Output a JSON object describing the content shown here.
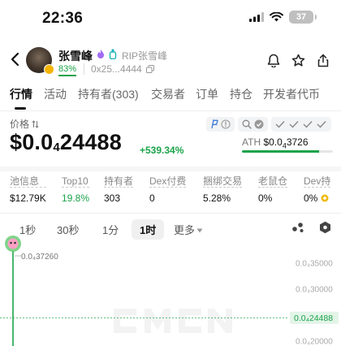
{
  "status_bar": {
    "time": "22:36",
    "battery": "37"
  },
  "header": {
    "name": "张雪峰",
    "subtitle": "RIP张雪峰",
    "percent": "83%",
    "address": "0x25...4444"
  },
  "tabs": [
    {
      "label": "行情",
      "active": true
    },
    {
      "label": "活动"
    },
    {
      "label": "持有者(303)"
    },
    {
      "label": "交易者"
    },
    {
      "label": "订单"
    },
    {
      "label": "持仓"
    },
    {
      "label": "开发者代币"
    }
  ],
  "price": {
    "label": "价格",
    "main": "$0.0",
    "main_sub": "4",
    "main_tail": "24488",
    "change": "+539.34%",
    "ath_label": "ATH",
    "ath_main": "$0.0",
    "ath_sub": "4",
    "ath_tail": "3726"
  },
  "stats": [
    {
      "label": "池信息",
      "value": "$12.79K"
    },
    {
      "label": "Top10",
      "value": "19.8%",
      "green": true
    },
    {
      "label": "持有者",
      "value": "303"
    },
    {
      "label": "Dex付费",
      "value": "0"
    },
    {
      "label": "捆绑交易",
      "value": "5.28%"
    },
    {
      "label": "老鼠仓",
      "value": "0%"
    },
    {
      "label": "Dev持",
      "value": "0%"
    }
  ],
  "intervals": [
    {
      "label": "1秒"
    },
    {
      "label": "30秒"
    },
    {
      "label": "1分"
    },
    {
      "label": "1时",
      "active": true
    },
    {
      "label": "更多"
    }
  ],
  "chart_data": {
    "type": "line",
    "high_label": "0.0₄37260",
    "y_ticks": [
      "0.0₄35000",
      "0.0₄30000",
      "0.0₄24488",
      "0.0₄20000"
    ],
    "y_tick_values": [
      3.5e-05,
      3e-05,
      2.4488e-05,
      2e-05
    ],
    "current_price": 2.4488e-05,
    "high": 3.726e-05
  },
  "colors": {
    "green": "#1aa34a",
    "accent": "#111111"
  }
}
